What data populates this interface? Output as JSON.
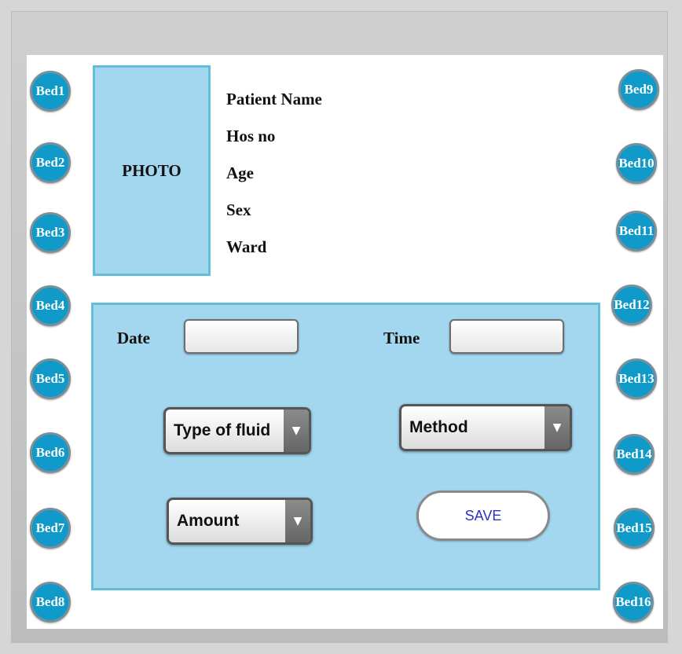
{
  "patient": {
    "photo_label": "PHOTO",
    "fields": [
      "Patient Name",
      "Hos no",
      "Age",
      "Sex",
      "Ward"
    ]
  },
  "beds_left": [
    "Bed1",
    "Bed2",
    "Bed3",
    "Bed4",
    "Bed5",
    "Bed6",
    "Bed7",
    "Bed8"
  ],
  "beds_right": [
    "Bed9",
    "Bed10",
    "Bed11",
    "Bed12",
    "Bed13",
    "Bed14",
    "Bed15",
    "Bed16"
  ],
  "form": {
    "date_label": "Date",
    "date_value": "",
    "time_label": "Time",
    "time_value": "",
    "type_of_fluid": "Type of fluid",
    "method": "Method",
    "amount": "Amount",
    "save_label": "SAVE"
  },
  "colors": {
    "bed_button": "#0f9ac9",
    "panel": "#a3d7f0",
    "panel_border": "#61bfd8",
    "save_text": "#2a33c8"
  },
  "icons": {
    "dropdown_arrow": "triangle-down-icon"
  }
}
